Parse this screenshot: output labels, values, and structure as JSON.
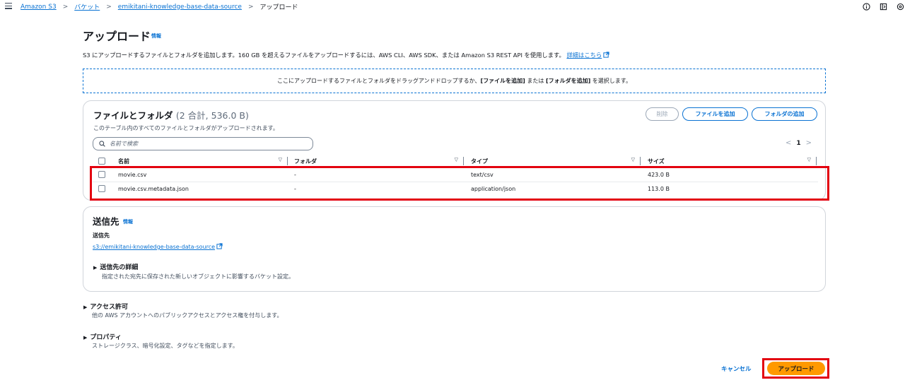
{
  "breadcrumb": {
    "items": [
      "Amazon S3",
      "バケット",
      "emikitani-knowledge-base-data-source"
    ],
    "current": "アップロード"
  },
  "header": {
    "title": "アップロード",
    "info": "情報",
    "description": "S3 にアップロードするファイルとフォルダを追加します。160 GB を超えるファイルをアップロードするには、AWS CLI、AWS SDK、または Amazon S3 REST API を使用します。",
    "learn_more": "詳細はこちら"
  },
  "dropzone": {
    "prefix": "ここにアップロードするファイルとフォルダをドラッグアンドドロップするか、",
    "add_files": "[ファイルを追加]",
    "or": " または ",
    "add_folder": "[フォルダを追加]",
    "suffix": " を選択します。"
  },
  "files_panel": {
    "title": "ファイルとフォルダ",
    "count": "(2 合計, 536.0 B)",
    "subtitle": "このテーブル内のすべてのファイルとフォルダがアップロードされます。",
    "delete_label": "削除",
    "add_files_label": "ファイルを追加",
    "add_folder_label": "フォルダの追加",
    "search_placeholder": "名前で検索",
    "page": "1",
    "columns": [
      "名前",
      "フォルダ",
      "タイプ",
      "サイズ"
    ],
    "rows": [
      {
        "name": "movie.csv",
        "folder": "-",
        "type": "text/csv",
        "size": "423.0 B"
      },
      {
        "name": "movie.csv.metadata.json",
        "folder": "-",
        "type": "application/json",
        "size": "113.0 B"
      }
    ]
  },
  "destination": {
    "title": "送信先",
    "info": "情報",
    "label": "送信先",
    "link": "s3://emikitani-knowledge-base-data-source",
    "details_title": "送信先の詳細",
    "details_desc": "指定された宛先に保存された新しいオブジェクトに影響するバケット設定。"
  },
  "permissions": {
    "title": "アクセス許可",
    "desc": "他の AWS アカウントへのパブリックアクセスとアクセス権を付与します。"
  },
  "properties": {
    "title": "プロパティ",
    "desc": "ストレージクラス、暗号化設定、タグなどを指定します。"
  },
  "footer": {
    "cancel_label": "キャンセル",
    "upload_label": "アップロード"
  },
  "colors": {
    "link": "#0972d3",
    "primary_button": "#ff9900",
    "highlight": "#e3000f"
  }
}
